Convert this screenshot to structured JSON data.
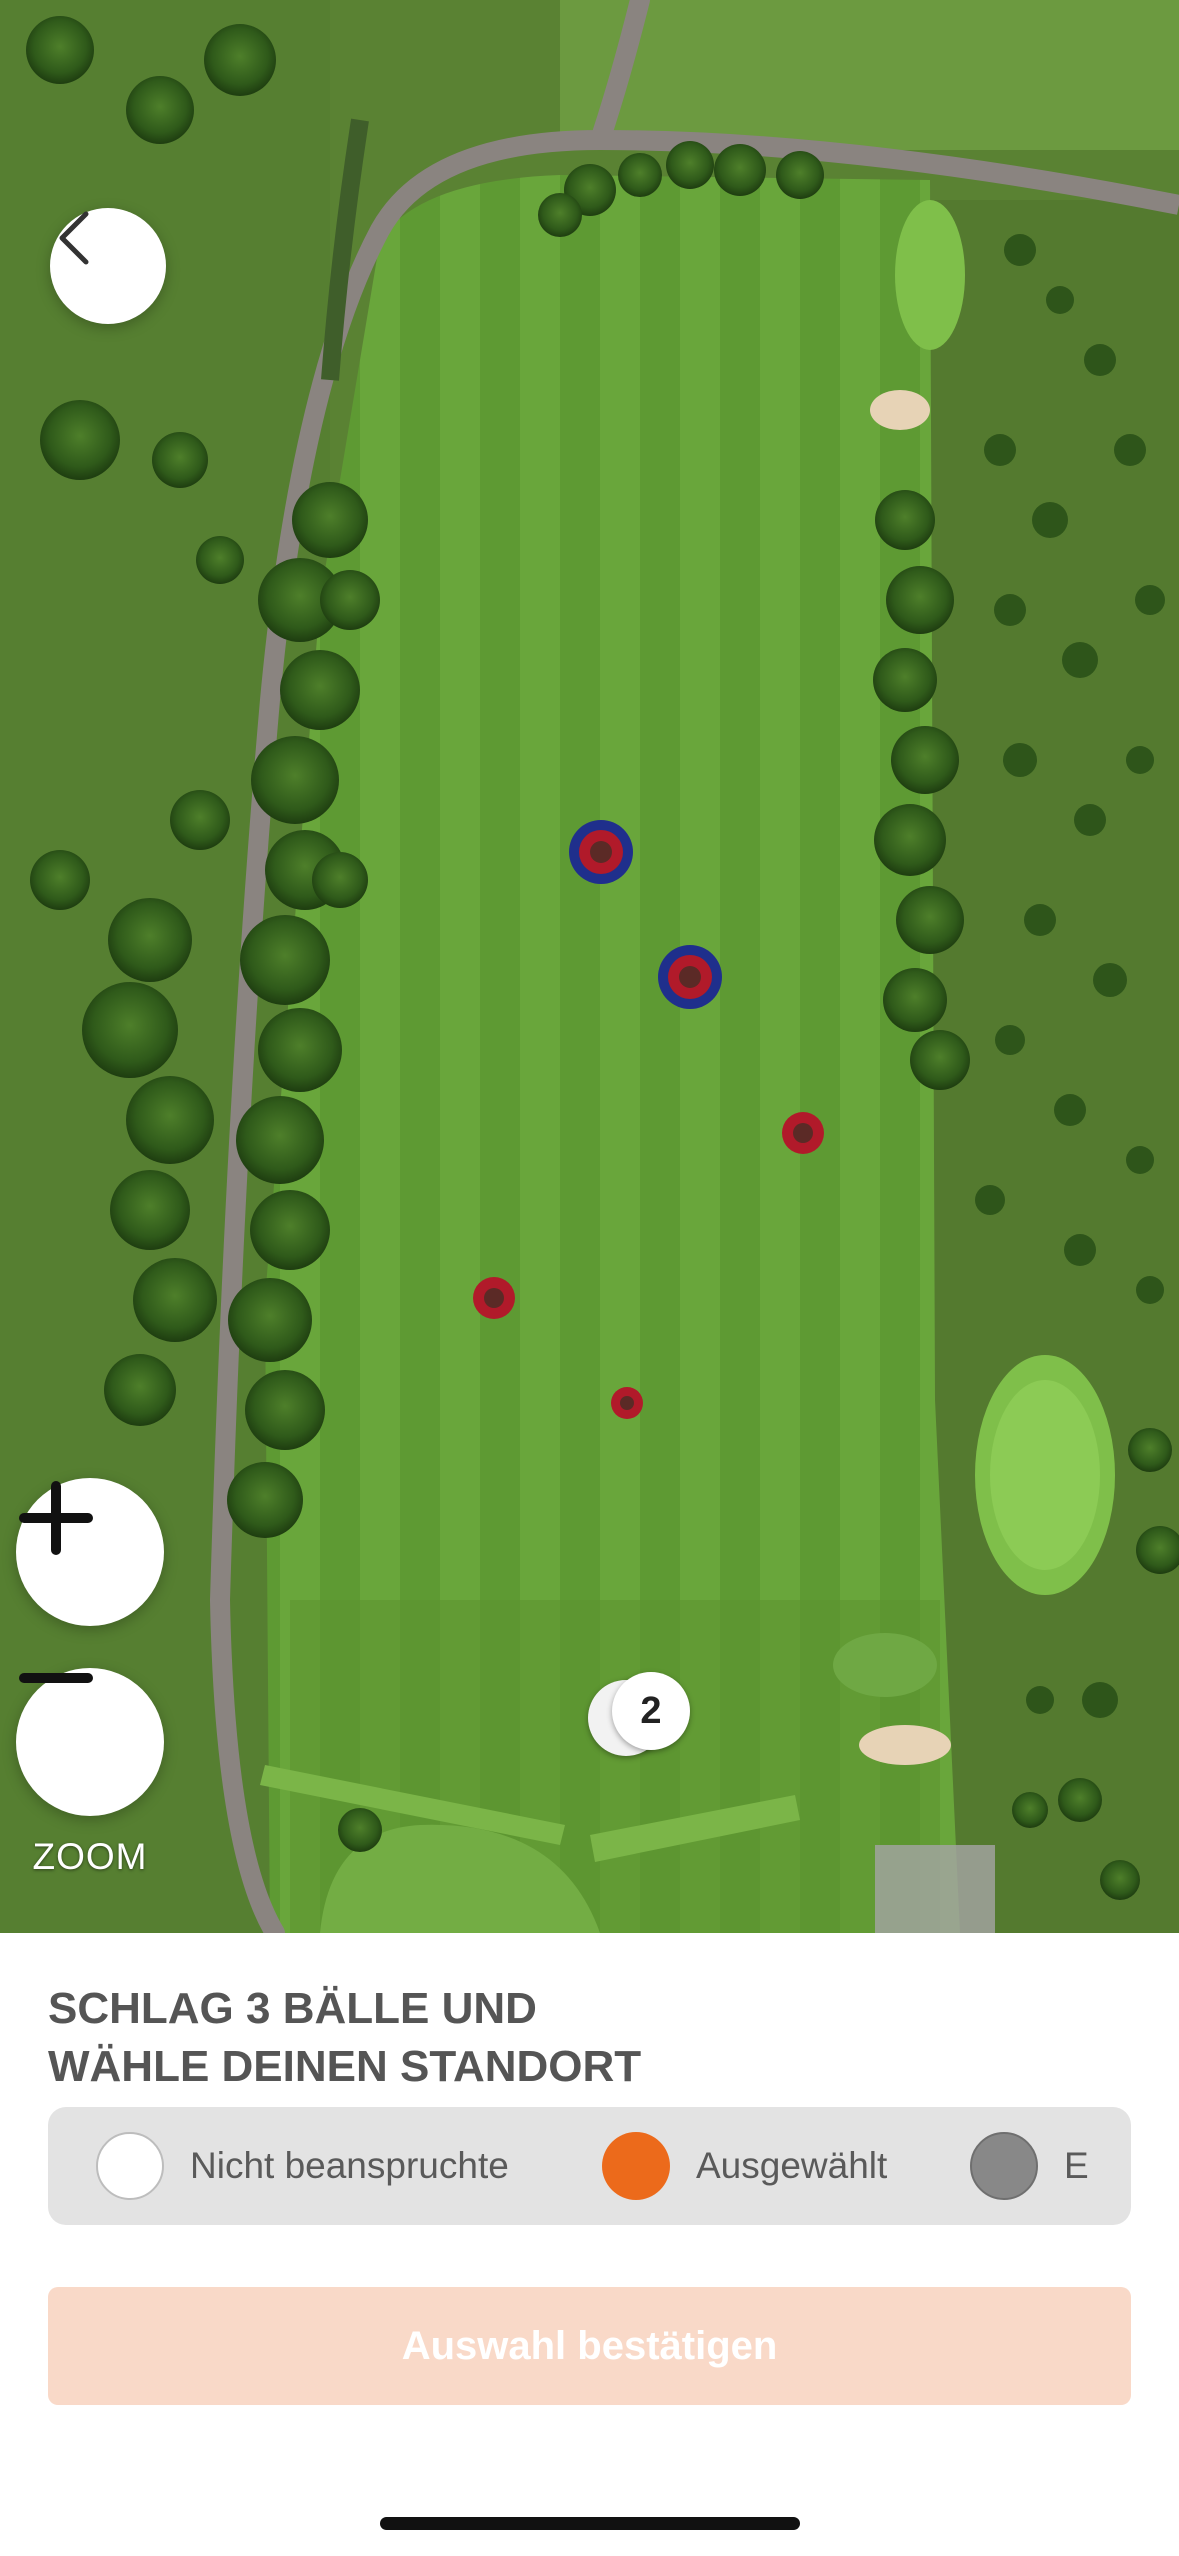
{
  "map": {
    "zoom_label": "ZOOM",
    "ball_stack_count": "2",
    "target_colors": {
      "outer": "#1f2f8c",
      "ring": "#b11a2a"
    }
  },
  "icons": {
    "back": "chevron-left-icon",
    "zoom_in": "plus-icon",
    "zoom_out": "minus-icon"
  },
  "panel": {
    "title_line1": "SCHLAG 3 BÄLLE UND",
    "title_line2": "WÄHLE DEINEN STANDORT",
    "legend": [
      {
        "label": "Nicht beanspruchte",
        "color": "#ffffff"
      },
      {
        "label": "Ausgewählt",
        "color": "#ec6a1b"
      },
      {
        "label": "E",
        "color": "#888888"
      }
    ],
    "confirm_label": "Auswahl bestätigen"
  },
  "colors": {
    "accent": "#ec6a1b",
    "confirm_disabled": "#f9d9c8"
  }
}
